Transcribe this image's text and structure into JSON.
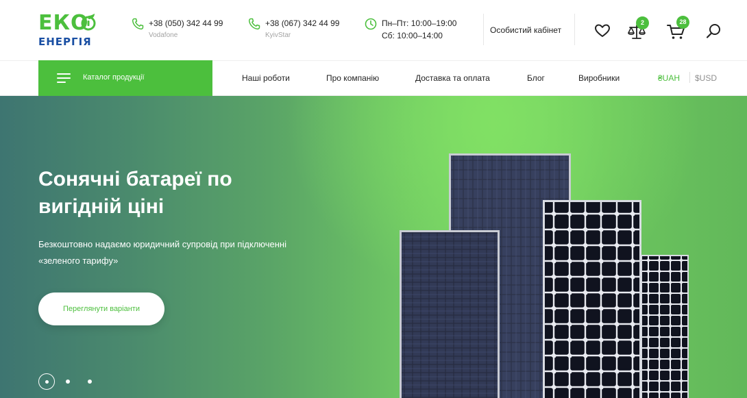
{
  "logo": {
    "brand": "ЕКО",
    "subtitle": "ЕНЕРГІЯ"
  },
  "contacts": [
    {
      "icon": "phone-icon",
      "line1": "+38 (050) 342 44 99",
      "line2": "Vodafone"
    },
    {
      "icon": "phone-icon",
      "line1": "+38 (067) 342 44 99",
      "line2": "KyivStar"
    },
    {
      "icon": "clock-icon",
      "line1": "Пн–Пт: 10:00–19:00",
      "line2": "Сб: 10:00–14:00"
    }
  ],
  "header": {
    "cabinet_label": "Особистий кабінет",
    "compare_count": "2",
    "cart_count": "28"
  },
  "nav": {
    "catalog_label": "Каталог продукції",
    "links": [
      "Наші роботи",
      "Про компанію",
      "Доставка та оплата",
      "Блог",
      "Виробники"
    ],
    "currency_active": "₴UAH",
    "currency_other": "$USD"
  },
  "hero": {
    "title": "Сонячні батареї по вигідній ціні",
    "description": "Безкоштовно надаємо юридичний супровід при підключенні «зеленого тарифу»",
    "button_label": "Переглянути варіанти",
    "slides_total": 3,
    "slide_active": 1
  },
  "colors": {
    "accent": "#4cbf3d",
    "brand_blue": "#1a4fa3",
    "text": "#222222",
    "muted": "#a3a3a3",
    "hero_start": "#3e7571",
    "hero_end": "#7bd866"
  }
}
